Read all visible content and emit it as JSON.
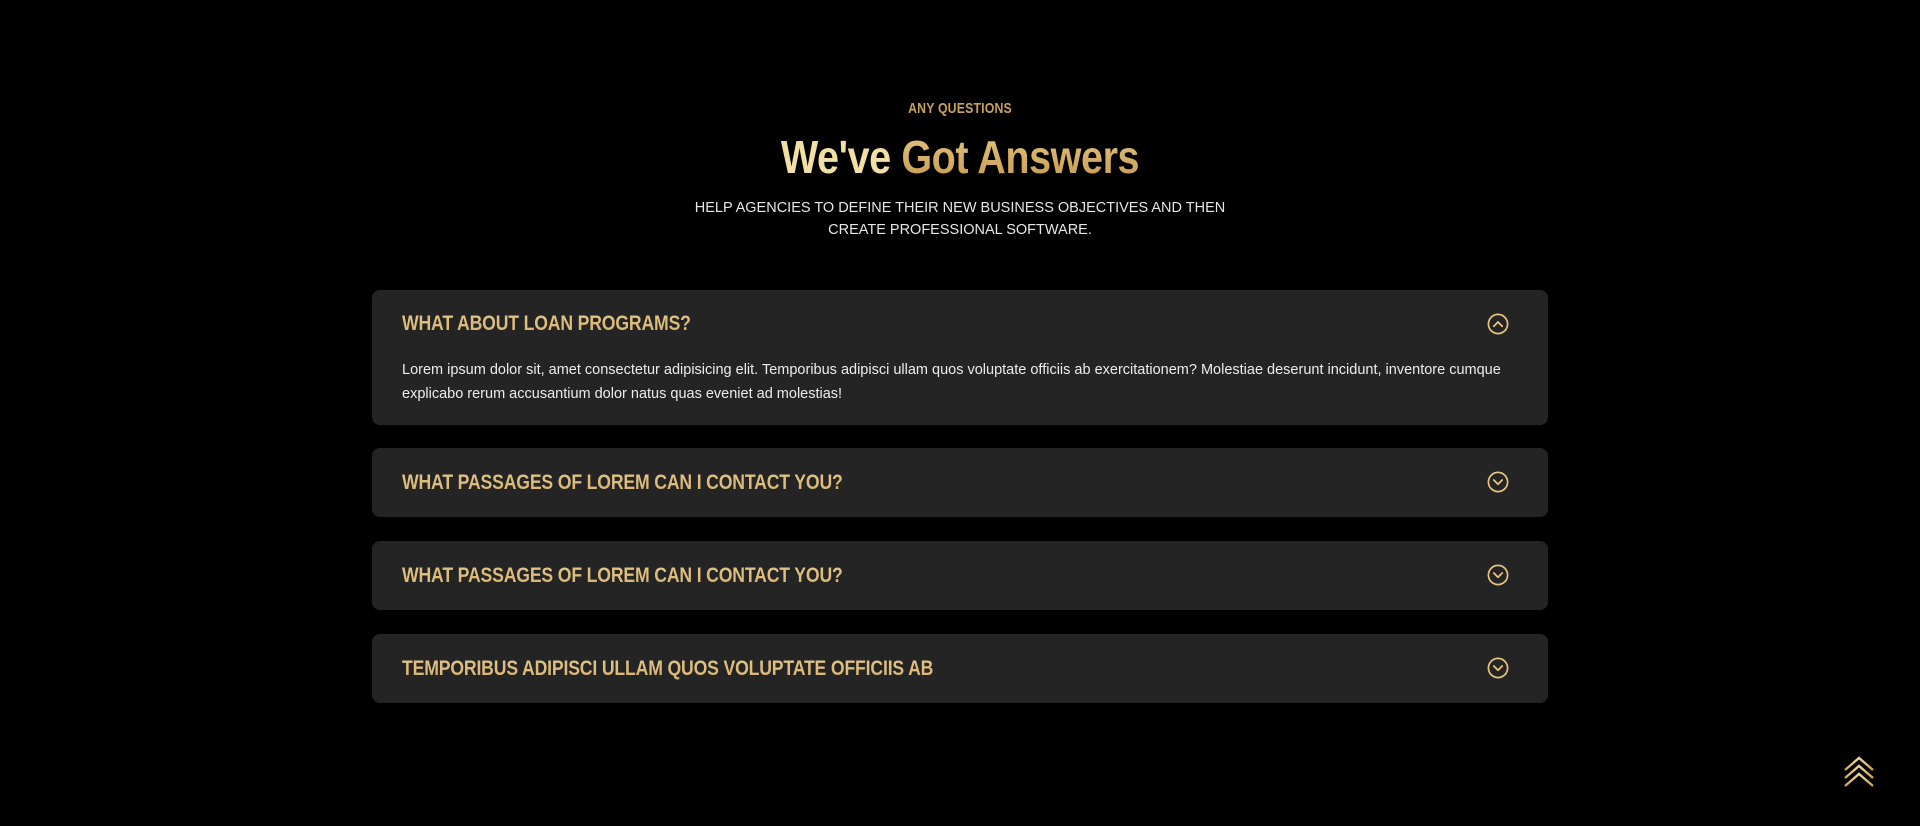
{
  "colors": {
    "background": "#000000",
    "card": "#242424",
    "gold": "#c9a15e",
    "gold_light": "#f1dfa5",
    "body_text": "#ececec"
  },
  "section": {
    "eyebrow": "ANY QUESTIONS",
    "headline_part1": "We've ",
    "headline_part2": "Got Answers",
    "subtext": "HELP AGENCIES TO DEFINE THEIR NEW BUSINESS OBJECTIVES AND THEN CREATE PROFESSIONAL SOFTWARE."
  },
  "faq": [
    {
      "question": "WHAT ABOUT LOAN PROGRAMS?",
      "answer": "Lorem ipsum dolor sit, amet consectetur adipisicing elit. Temporibus adipisci ullam quos voluptate officiis ab exercitationem? Molestiae deserunt incidunt, inventore cumque explicabo rerum accusantium dolor natus quas eveniet ad molestias!",
      "expanded": true,
      "toggle_icon": "chevron-up-circle-icon"
    },
    {
      "question": "WHAT PASSAGES OF LOREM CAN I CONTACT YOU?",
      "expanded": false,
      "toggle_icon": "chevron-down-circle-icon"
    },
    {
      "question": "WHAT PASSAGES OF LOREM CAN I CONTACT YOU?",
      "expanded": false,
      "toggle_icon": "chevron-down-circle-icon"
    },
    {
      "question": "TEMPORIBUS ADIPISCI ULLAM QUOS VOLUPTATE OFFICIIS AB",
      "expanded": false,
      "toggle_icon": "chevron-down-circle-icon"
    }
  ],
  "back_to_top": {
    "icon": "triple-chevron-up-icon"
  }
}
